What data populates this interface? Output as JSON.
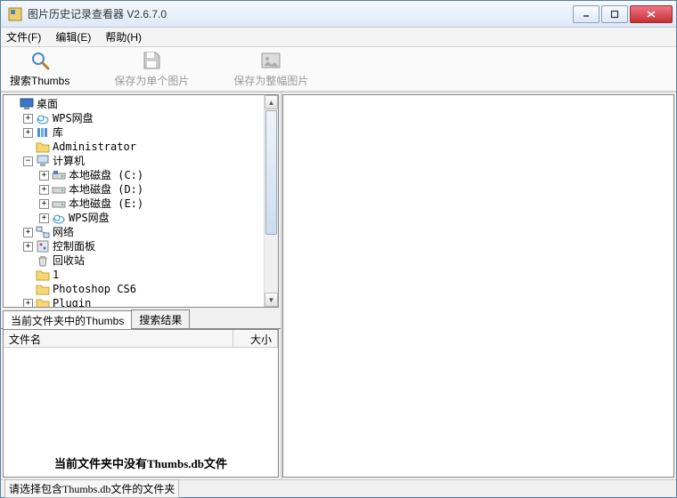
{
  "title": "图片历史记录查看器 V2.6.7.0",
  "menu": {
    "file": "文件(F)",
    "edit": "编辑(E)",
    "help": "帮助(H)"
  },
  "toolbar": {
    "search": "搜索Thumbs",
    "saveSingle": "保存为单个图片",
    "saveWhole": "保存为整幅图片"
  },
  "tree": [
    {
      "depth": 0,
      "exp": "none",
      "icon": "monitor",
      "label": "桌面"
    },
    {
      "depth": 1,
      "exp": "plus",
      "icon": "cloud",
      "label": "WPS网盘"
    },
    {
      "depth": 1,
      "exp": "plus",
      "icon": "library",
      "label": "库"
    },
    {
      "depth": 1,
      "exp": "none",
      "icon": "folder",
      "label": "Administrator"
    },
    {
      "depth": 1,
      "exp": "minus",
      "icon": "computer",
      "label": "计算机"
    },
    {
      "depth": 2,
      "exp": "plus",
      "icon": "drive-sys",
      "label": "本地磁盘 (C:)"
    },
    {
      "depth": 2,
      "exp": "plus",
      "icon": "drive",
      "label": "本地磁盘 (D:)"
    },
    {
      "depth": 2,
      "exp": "plus",
      "icon": "drive",
      "label": "本地磁盘 (E:)"
    },
    {
      "depth": 2,
      "exp": "plus",
      "icon": "cloud",
      "label": "WPS网盘"
    },
    {
      "depth": 1,
      "exp": "plus",
      "icon": "network",
      "label": "网络"
    },
    {
      "depth": 1,
      "exp": "plus",
      "icon": "control",
      "label": "控制面板"
    },
    {
      "depth": 1,
      "exp": "none",
      "icon": "recycle",
      "label": "回收站"
    },
    {
      "depth": 1,
      "exp": "none",
      "icon": "folder",
      "label": "1"
    },
    {
      "depth": 1,
      "exp": "none",
      "icon": "folder",
      "label": "Photoshop CS6"
    },
    {
      "depth": 1,
      "exp": "plus",
      "icon": "folder",
      "label": "Plugin"
    }
  ],
  "tabs": {
    "current": "当前文件夹中的Thumbs",
    "results": "搜索结果"
  },
  "columns": {
    "name": "文件名",
    "size": "大小"
  },
  "emptyMsg": "当前文件夹中没有Thumbs.db文件",
  "status": "请选择包含Thumbs.db文件的文件夹",
  "icons": {
    "monitor": "monitor",
    "cloud": "cloud",
    "library": "library",
    "folder": "folder",
    "computer": "computer",
    "drive-sys": "drive-sys",
    "drive": "drive",
    "network": "network",
    "control": "control",
    "recycle": "recycle"
  }
}
